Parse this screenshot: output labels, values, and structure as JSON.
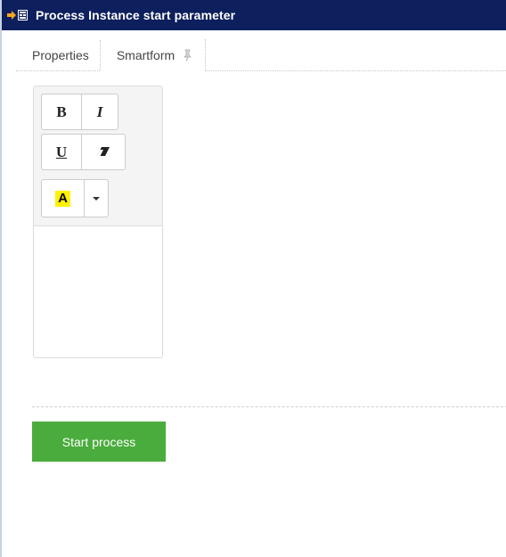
{
  "window": {
    "title": "Process Instance start parameter",
    "title_icon": "process-start-icon",
    "titlebar_color": "#0d1f5c"
  },
  "tabs": [
    {
      "label": "Properties",
      "active": false
    },
    {
      "label": "Smartform",
      "active": true,
      "icon": "pin-icon"
    }
  ],
  "editor": {
    "toolbar": {
      "bold_label": "B",
      "italic_label": "I",
      "underline_label": "U",
      "eraser_icon": "eraser-icon",
      "highlight_label": "A",
      "highlight_color": "#fff200",
      "dropdown_icon": "caret-down-icon"
    },
    "content": ""
  },
  "actions": {
    "start_label": "Start process",
    "start_color": "#4aac3c"
  }
}
